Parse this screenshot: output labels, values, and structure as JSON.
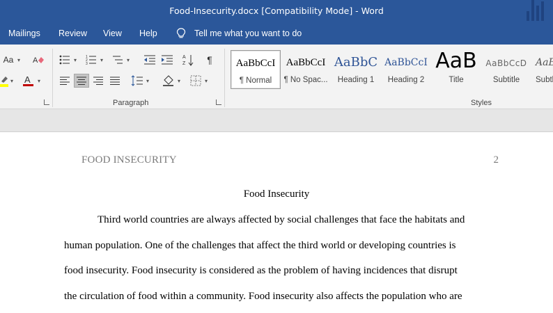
{
  "window": {
    "title": "Food-Insecurity.docx [Compatibility Mode]  -  Word"
  },
  "menu": {
    "items": [
      "Mailings",
      "Review",
      "View",
      "Help"
    ],
    "tell_me": "Tell me what you want to do"
  },
  "ribbon": {
    "font_group": {
      "change_case": "Aa",
      "font_color": "A"
    },
    "paragraph_group": {
      "label": "Paragraph",
      "active_alignment": "align-left"
    },
    "styles_group": {
      "label": "Styles",
      "styles": [
        {
          "preview": "AaBbCcI",
          "name": "¶ Normal"
        },
        {
          "preview": "AaBbCcI",
          "name": "¶ No Spac..."
        },
        {
          "preview": "AaBbC",
          "name": "Heading 1"
        },
        {
          "preview": "AaBbCcI",
          "name": "Heading 2"
        },
        {
          "preview": "AaB",
          "name": "Title"
        },
        {
          "preview": "AaBbCcD",
          "name": "Subtitle"
        },
        {
          "preview": "AaB",
          "name": "Subtl"
        }
      ]
    }
  },
  "colors": {
    "word_blue": "#2b579a",
    "font_color_red": "#c00000",
    "highlight_yellow": "#ffff00",
    "heading_blue": "#2f5496"
  },
  "document": {
    "header": "FOOD INSECURITY",
    "page_number": "2",
    "title": "Food Insecurity",
    "lines": [
      "Third world countries are always affected by social challenges that face the habitats and",
      "human population. One of the challenges that affect the third world or developing countries is",
      "food insecurity. Food insecurity is considered as the problem of having incidences that disrupt",
      "the circulation of food within a community. Food insecurity also affects the population who are"
    ]
  }
}
